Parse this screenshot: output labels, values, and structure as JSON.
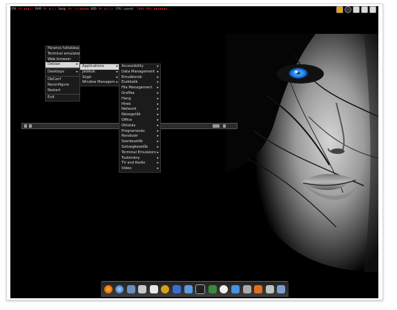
{
  "conky": {
    "cpu_label": "CPU",
    "cpu_value": "3%",
    "ram_label": "RAM",
    "ram_value": "9%",
    "swap_label": "Swap",
    "swap_value": "0%",
    "hdd_label": "HDD",
    "hdd_value": "8%",
    "cpu_speed_label": "CPU speed:",
    "cpu_speed_value": "1000 MHz"
  },
  "root_menu": {
    "items": [
      {
        "label": "Parancs futtatása"
      },
      {
        "label": "Terminal emulator"
      },
      {
        "label": "Web browser"
      },
      {
        "label": "Debian"
      },
      {
        "label": "Desktops"
      },
      {
        "label": "ObConf"
      },
      {
        "label": "Reconfigure"
      },
      {
        "label": "Restart"
      },
      {
        "label": "Exit"
      }
    ]
  },
  "debian_menu": {
    "items": [
      {
        "label": "Applications"
      },
      {
        "label": "Játékok"
      },
      {
        "label": "Súgó"
      },
      {
        "label": "Window Managers"
      }
    ]
  },
  "applications_menu": {
    "items": [
      {
        "label": "Accessibility"
      },
      {
        "label": "Data Management"
      },
      {
        "label": "Emulátorok"
      },
      {
        "label": "Eszközök"
      },
      {
        "label": "File Management"
      },
      {
        "label": "Grafika"
      },
      {
        "label": "Hang"
      },
      {
        "label": "Hírek"
      },
      {
        "label": "Network"
      },
      {
        "label": "Nézegetők"
      },
      {
        "label": "Office"
      },
      {
        "label": "Oktatás"
      },
      {
        "label": "Programozás"
      },
      {
        "label": "Rendszer"
      },
      {
        "label": "Szerkesztők"
      },
      {
        "label": "Szövegkezelők"
      },
      {
        "label": "Terminal Emulators"
      },
      {
        "label": "Tudomány"
      },
      {
        "label": "TV and Radio"
      },
      {
        "label": "Video"
      }
    ]
  },
  "colors": {
    "desktop_bg": "#000000",
    "menu_bg": "#1b1b1b",
    "menu_selected": "#d9d9d9",
    "eye_blue": "#2f8fe6",
    "conky_alert": "#e03030"
  },
  "dock": {
    "icons": [
      "firefox-icon",
      "globe-icon",
      "network-icon",
      "media-player-icon",
      "document-icon",
      "image-viewer-icon",
      "folder-icon",
      "mail-icon",
      "terminal-icon",
      "monitor-icon",
      "camera-icon",
      "chat-icon",
      "audio-icon",
      "package-icon",
      "tools-icon",
      "trash-icon"
    ]
  }
}
